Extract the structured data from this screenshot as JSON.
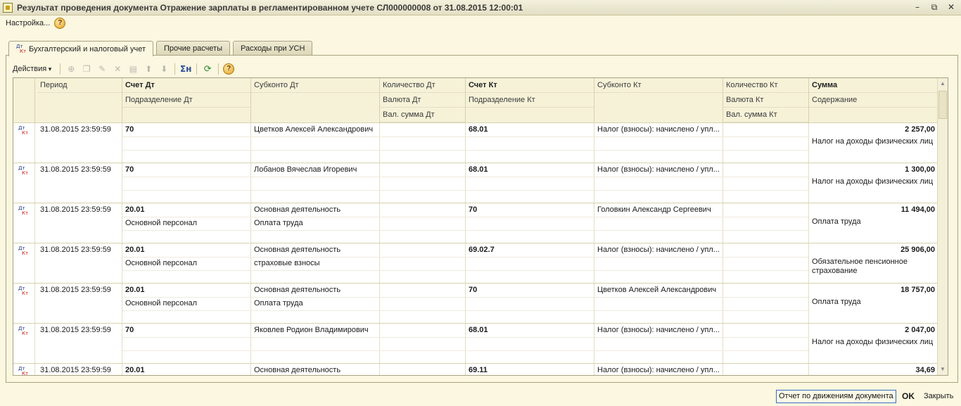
{
  "window": {
    "title": "Результат проведения документа Отражение зарплаты в регламентированном учете СЛ000000008 от 31.08.2015 12:00:01",
    "controls": [
      "–",
      "⧉",
      "✕"
    ]
  },
  "menu": {
    "settings": "Настройка...",
    "help": "?"
  },
  "tabs": [
    {
      "label": "Бухгалтерский и налоговый учет",
      "active": true
    },
    {
      "label": "Прочие расчеты",
      "active": false
    },
    {
      "label": "Расходы при УСН",
      "active": false
    }
  ],
  "toolbar": {
    "actions": "Действия",
    "icons": [
      "add-icon",
      "copy-icon",
      "edit-icon",
      "delete-icon",
      "save-icon",
      "move-up-icon",
      "move-down-icon",
      "sum-icon",
      "refresh-icon",
      "help-icon"
    ],
    "help": "?",
    "sum_glyph": "Σн",
    "icon_dt": "Дт",
    "icon_kt": "Кт"
  },
  "table": {
    "headers": {
      "period": "Период",
      "acc_dt": "Счет Дт",
      "sub_dt": "Субконто Дт",
      "qty_dt": "Количество Дт",
      "acc_kt": "Счет Кт",
      "sub_kt": "Субконто Кт",
      "qty_kt": "Количество Кт",
      "sum": "Сумма",
      "dept_dt": "Подразделение Дт",
      "cur_dt": "Валюта Дт",
      "dept_kt": "Подразделение Кт",
      "cur_kt": "Валюта Кт",
      "content": "Содержание",
      "cursum_dt": "Вал. сумма Дт",
      "cursum_kt": "Вал. сумма Кт"
    },
    "rows": [
      {
        "period": "31.08.2015 23:59:59",
        "acc_dt": "70",
        "dept_dt": "",
        "sub_dt": "Цветков Алексей Александрович",
        "sub_dt2": "",
        "acc_kt": "68.01",
        "sub_kt": "Налог (взносы): начислено / упл...",
        "sum": "2 257,00",
        "content": "Налог на доходы физических лиц"
      },
      {
        "period": "31.08.2015 23:59:59",
        "acc_dt": "70",
        "dept_dt": "",
        "sub_dt": "Лобанов Вячеслав Игоревич",
        "sub_dt2": "",
        "acc_kt": "68.01",
        "sub_kt": "Налог (взносы): начислено / упл...",
        "sum": "1 300,00",
        "content": "Налог на доходы физических лиц"
      },
      {
        "period": "31.08.2015 23:59:59",
        "acc_dt": "20.01",
        "dept_dt": "Основной персонал",
        "sub_dt": "Основная деятельность",
        "sub_dt2": "Оплата труда",
        "acc_kt": "70",
        "sub_kt": "Головкин Александр Сергеевич",
        "sum": "11 494,00",
        "content": "Оплата труда"
      },
      {
        "period": "31.08.2015 23:59:59",
        "acc_dt": "20.01",
        "dept_dt": "Основной персонал",
        "sub_dt": "Основная деятельность",
        "sub_dt2": "страховые взносы",
        "acc_kt": "69.02.7",
        "sub_kt": "Налог (взносы): начислено / упл...",
        "sum": "25 906,00",
        "content": "Обязательное пенсионное страхование"
      },
      {
        "period": "31.08.2015 23:59:59",
        "acc_dt": "20.01",
        "dept_dt": "Основной персонал",
        "sub_dt": "Основная деятельность",
        "sub_dt2": "Оплата труда",
        "acc_kt": "70",
        "sub_kt": "Цветков Алексей Александрович",
        "sum": "18 757,00",
        "content": "Оплата труда"
      },
      {
        "period": "31.08.2015 23:59:59",
        "acc_dt": "70",
        "dept_dt": "",
        "sub_dt": "Яковлев Родион Владимирович",
        "sub_dt2": "",
        "acc_kt": "68.01",
        "sub_kt": "Налог (взносы): начислено / упл...",
        "sum": "2 047,00",
        "content": "Налог на доходы физических лиц"
      },
      {
        "period": "31.08.2015 23:59:59",
        "acc_dt": "20.01",
        "dept_dt": "",
        "sub_dt": "Основная деятельность",
        "sub_dt2": "",
        "acc_kt": "69.11",
        "sub_kt": "Налог (взносы): начислено / упл...",
        "sum": "34,69",
        "content": ""
      }
    ]
  },
  "footer": {
    "report": "Отчет по движениям документа",
    "ok": "OK",
    "close": "Закрыть"
  }
}
